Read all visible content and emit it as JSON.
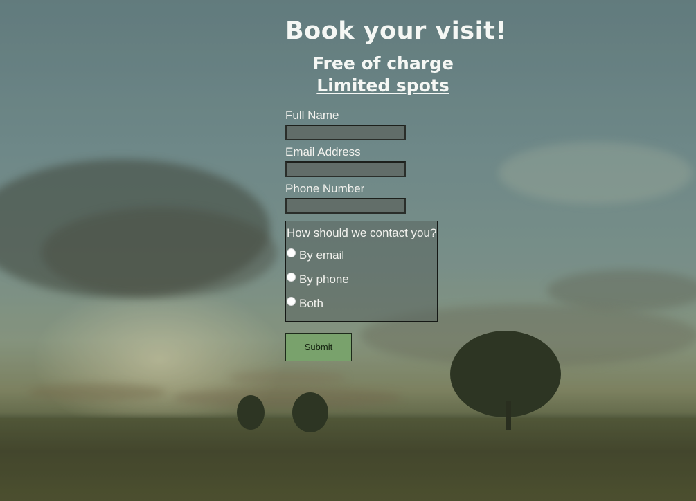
{
  "page": {
    "heading": "Book your visit!",
    "subheading_line1": "Free of charge",
    "subheading_line2": "Limited spots"
  },
  "form": {
    "full_name": {
      "label": "Full Name",
      "value": "",
      "placeholder": ""
    },
    "email": {
      "label": "Email Address",
      "value": "",
      "placeholder": ""
    },
    "phone": {
      "label": "Phone Number",
      "value": "",
      "placeholder": ""
    },
    "contact": {
      "question": "How should we contact you?",
      "options": [
        {
          "label": "By email",
          "selected": false
        },
        {
          "label": "By phone",
          "selected": false
        },
        {
          "label": "Both",
          "selected": false
        }
      ]
    },
    "submit_label": "Submit"
  },
  "colors": {
    "submit_bg": "#79a26c",
    "heading_text": "#f5f7f4"
  }
}
